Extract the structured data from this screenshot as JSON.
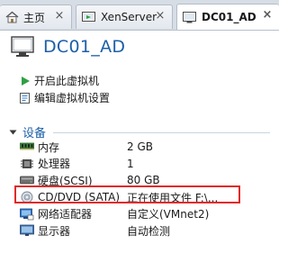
{
  "tabs": [
    {
      "label": "主页",
      "icon": "home-icon",
      "active": false
    },
    {
      "label": "XenServer",
      "icon": "vm-tab-icon",
      "active": false
    },
    {
      "label": "DC01_AD",
      "icon": "vm-tab-icon",
      "active": true
    }
  ],
  "vm": {
    "title": "DC01_AD",
    "icon": "virtual-machine-icon"
  },
  "actions": [
    {
      "label": "开启此虚拟机",
      "icon": "play-icon"
    },
    {
      "label": "编辑虚拟机设置",
      "icon": "edit-settings-icon"
    }
  ],
  "devices_section": {
    "label": "设备"
  },
  "devices": [
    {
      "name": "内存",
      "value": "2 GB",
      "icon": "memory-icon"
    },
    {
      "name": "处理器",
      "value": "1",
      "icon": "processor-icon"
    },
    {
      "name": "硬盘(SCSI)",
      "value": "80 GB",
      "icon": "hard-disk-icon"
    },
    {
      "name": "CD/DVD (SATA)",
      "value": "正在使用文件 F:\\...",
      "icon": "cd-dvd-icon"
    },
    {
      "name": "网络适配器",
      "value": "自定义(VMnet2)",
      "icon": "network-adapter-icon"
    },
    {
      "name": "显示器",
      "value": "自动检测",
      "icon": "display-icon"
    }
  ],
  "colors": {
    "accent": "#1d5fa8",
    "highlight": "#e12a2a",
    "play": "#2ea043"
  }
}
